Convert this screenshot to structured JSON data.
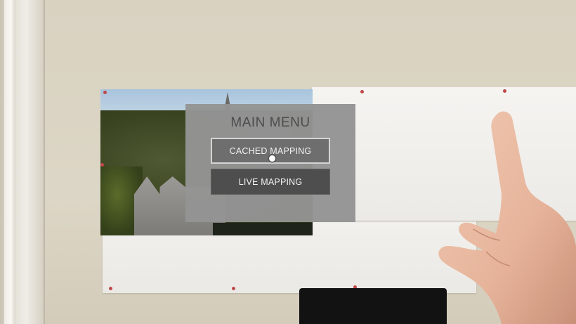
{
  "menu": {
    "title": "MAIN MENU",
    "buttons": [
      {
        "label": "CACHED MAPPING",
        "state": "hovered"
      },
      {
        "label": "LIVE MAPPING",
        "state": "normal"
      }
    ]
  },
  "cursor": {
    "icon": "gaze-cursor-icon"
  },
  "colors": {
    "panel": "#949494",
    "button_hover": "#6e6e6e",
    "button_normal": "#4e4e4e",
    "title_text": "#4c4c4c",
    "button_text": "#f2f2f2"
  }
}
